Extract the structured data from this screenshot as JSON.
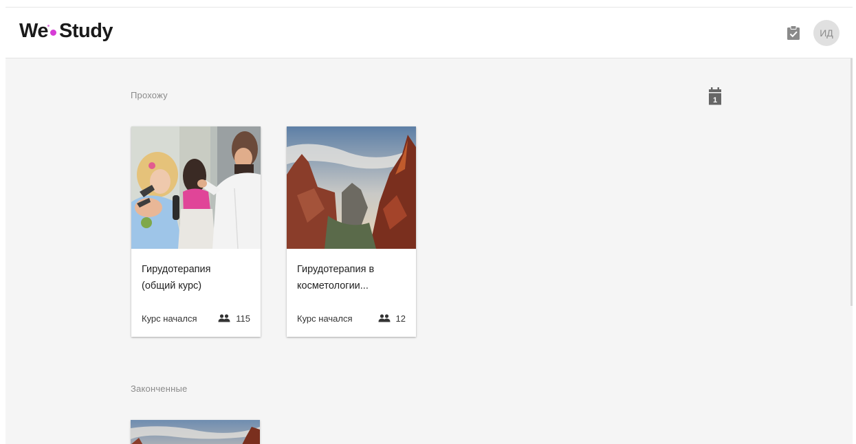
{
  "header": {
    "logo_left": "We",
    "logo_right": "Study",
    "brand_color": "#d63cd6",
    "tasks_icon": "clipboard-check-icon",
    "avatar_initials": "ИД"
  },
  "calendar_icon": "calendar-icon",
  "calendar_day": "1",
  "sections": [
    {
      "title": "Прохожу",
      "courses": [
        {
          "title_line1": "Гирудотерапия",
          "title_line2": "(общий курс)",
          "status": "Курс начался",
          "members_icon": "people-icon",
          "members": "115",
          "image": "therapy-session-photo"
        },
        {
          "title_line1": "Гирудотерапия в",
          "title_line2": "косметологии...",
          "status": "Курс начался",
          "members_icon": "people-icon",
          "members": "12",
          "image": "canyon-landscape-photo"
        }
      ]
    },
    {
      "title": "Законченные",
      "courses": [
        {
          "image": "canyon-landscape-photo"
        }
      ]
    }
  ]
}
